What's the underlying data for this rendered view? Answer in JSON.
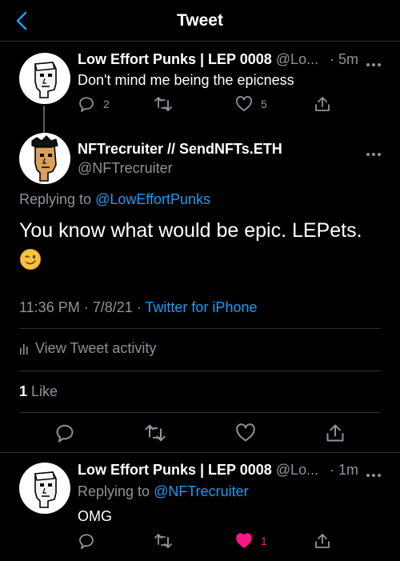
{
  "nav": {
    "title": "Tweet"
  },
  "tweet1": {
    "name": "Low Effort Punks | LEP 0008",
    "handle": "@Lo...",
    "time": "· 5m",
    "text": "Don't mind me being the epicness",
    "replies": "2",
    "likes": "5"
  },
  "main": {
    "name": "NFTrecruiter // SendNFTs.ETH",
    "handle": "@NFTrecruiter",
    "replying_prefix": "Replying to ",
    "replying_to": "@LowEffortPunks",
    "text": "You know what would be epic. LEPets.",
    "timestamp": "11:36 PM · 7/8/21 · ",
    "source": "Twitter for iPhone",
    "activity": "View Tweet activity",
    "likes_count": "1",
    "likes_label": " Like"
  },
  "tweet3": {
    "name": "Low Effort Punks | LEP 0008",
    "handle": "@Lo...",
    "time": "· 1m",
    "replying_prefix": "Replying to ",
    "replying_to": "@NFTrecruiter",
    "text": "OMG",
    "likes": "1"
  },
  "colors": {
    "accent": "#1d9bf0",
    "like": "#f91880",
    "muted": "#8b949b"
  }
}
